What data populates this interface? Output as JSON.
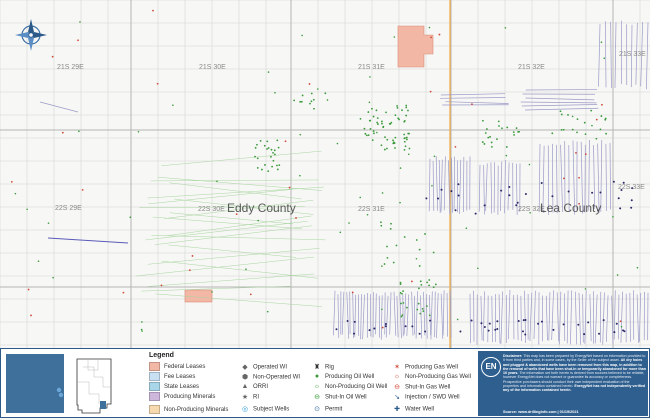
{
  "map": {
    "township_labels": [
      "21S 29E",
      "21S 30E",
      "21S 31E",
      "21S 32E",
      "21S 33E",
      "22S 29E",
      "22S 30E",
      "22S 31E",
      "22S 32E",
      "22S 33E"
    ],
    "county_labels": [
      "Eddy County",
      "Lea County"
    ],
    "colors": {
      "federal_lease": "#f3b7a5",
      "county_line": "#f0b25a",
      "horizontal_well": "#9a9ac8",
      "producing_oil": "#3a9a3a",
      "producing_gas": "#d04a3a",
      "section_line": "#d5d5d5",
      "township_line": "#b5b5b5"
    },
    "compass_icon": "compass-rose-icon"
  },
  "legend": {
    "title": "Legend",
    "col1": [
      {
        "label": "Federal Leases",
        "color": "#f3b7a5"
      },
      {
        "label": "Fee Leases",
        "color": "#c9dff2"
      },
      {
        "label": "State Leases",
        "color": "#a9d6e8"
      },
      {
        "label": "Producing Minerals",
        "color": "#cdb8dc"
      },
      {
        "label": "Non-Producing Minerals",
        "color": "#f7d9b0"
      }
    ],
    "col2": [
      {
        "label": "Operated WI",
        "icon": "diamond-icon"
      },
      {
        "label": "Non-Operated WI",
        "icon": "hexagon-icon"
      },
      {
        "label": "ORRI",
        "icon": "triangle-icon"
      },
      {
        "label": "RI",
        "icon": "star-icon"
      },
      {
        "label": "Subject Wells",
        "icon": "ring-icon"
      }
    ],
    "col3": [
      {
        "label": "Rig",
        "icon": "rig-icon"
      },
      {
        "label": "Producing Oil Well",
        "icon": "green-dot-icon"
      },
      {
        "label": "Non-Producing Oil Well",
        "icon": "oil-open-icon"
      },
      {
        "label": "Shut-In Oil Well",
        "icon": "oil-shutin-icon"
      },
      {
        "label": "Permit",
        "icon": "permit-icon"
      }
    ],
    "col4": [
      {
        "label": "Producing Gas Well",
        "icon": "gas-icon"
      },
      {
        "label": "Non-Producing Gas Well",
        "icon": "gas-open-icon"
      },
      {
        "label": "Shut-In Gas Well",
        "icon": "gas-shutin-icon"
      },
      {
        "label": "Injection / SWD Well",
        "icon": "injection-icon"
      },
      {
        "label": "Water Well",
        "icon": "water-icon"
      }
    ]
  },
  "disclaimer": {
    "logo": "EN",
    "lead": "Disclaimer:",
    "body1": "This map has been prepared by EnergyNet based on information provided to it from third parties and, in some cases, by the Seller of the subject asset.",
    "bold1": "All dry holes and plugged & abandoned wells have been removed from this map, in addition to the removal of wells that have been shut-in or temporarily abandoned for more than 10 years.",
    "body2": "The information set forth herein is derived from sources believed to be reliable, however EnergyNet does not warrant or guarantee its accuracy or completeness. Prospective purchasers should conduct their own independent evaluation of the properties and information contained herein.",
    "bold2": "EnergyNet has not independently verified any of the information contained herein.",
    "source": "Source: www.drillinginfo.com | 01/19/2021"
  }
}
